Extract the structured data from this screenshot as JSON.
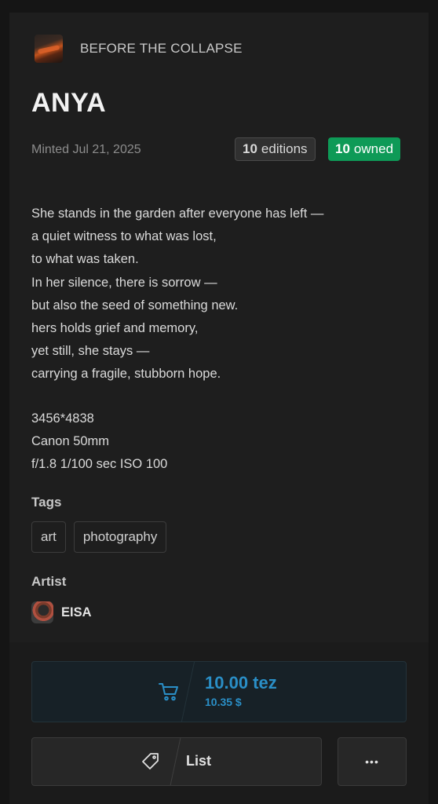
{
  "collection": {
    "name": "BEFORE THE COLLAPSE"
  },
  "token": {
    "title": "ANYA",
    "minted": "Minted Jul 21, 2025",
    "editions_count": "10",
    "editions_label": "editions",
    "owned_count": "10",
    "owned_label": "owned",
    "description": "She stands in the garden after everyone has left —\na quiet witness to what was lost,\nto what was taken.\nIn her silence, there is sorrow —\nbut also the seed of something new.\nhers holds grief and memory,\nyet still, she stays —\ncarrying a fragile, stubborn hope.",
    "specs": [
      "3456*4838",
      "Canon 50mm",
      "f/1.8 1/100 sec ISO 100"
    ]
  },
  "tags": {
    "label": "Tags",
    "items": [
      "art",
      "photography"
    ]
  },
  "artist": {
    "label": "Artist",
    "name": "EISA"
  },
  "actions": {
    "price": "10.00 tez",
    "price_usd": "10.35 $",
    "list_label": "List",
    "more_label": "•••",
    "accent_color": "#2a8fc7",
    "owned_color": "#0e9a57",
    "icons": {
      "buy": "cart-icon",
      "list": "price-tag-icon",
      "more": "more-icon"
    }
  }
}
